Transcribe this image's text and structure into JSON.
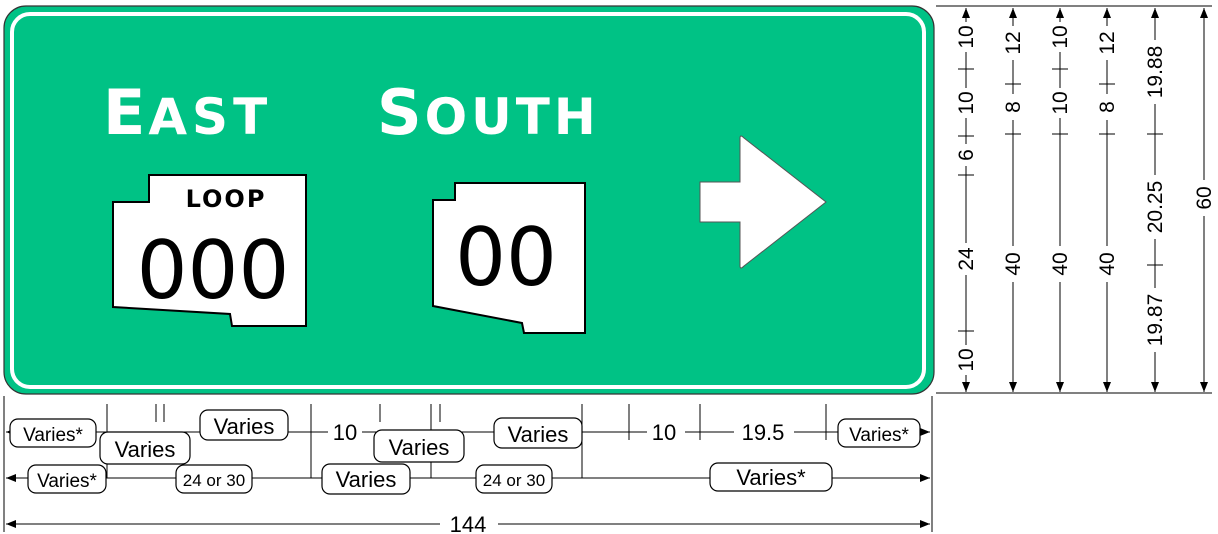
{
  "sign": {
    "background_color": "#00c285",
    "legend_color": "#ffffff",
    "dest1_first": "E",
    "dest1_rest": "AST",
    "dest2_first": "S",
    "dest2_rest": "OUTH",
    "shield1_label": "LOOP",
    "shield1_number": "000",
    "shield2_number": "00",
    "arrow": "right-arrow-icon"
  },
  "vertical_dims": {
    "col1": [
      "10",
      "10",
      "6",
      "24",
      "10"
    ],
    "col2": [
      "12",
      "8",
      "40"
    ],
    "col3": [
      "10",
      "10",
      "40"
    ],
    "col4": [
      "12",
      "8",
      "40"
    ],
    "col5": [
      "19.88",
      "20.25",
      "19.87"
    ],
    "total": "60"
  },
  "horizontal_dims": {
    "row1": [
      "Varies*",
      "Varies",
      "Varies",
      "10",
      "Varies",
      "Varies",
      "10",
      "19.5",
      "Varies*"
    ],
    "row2": [
      "Varies*",
      "24 or 30",
      "Varies",
      "24 or 30",
      "Varies*"
    ],
    "total": "144"
  }
}
